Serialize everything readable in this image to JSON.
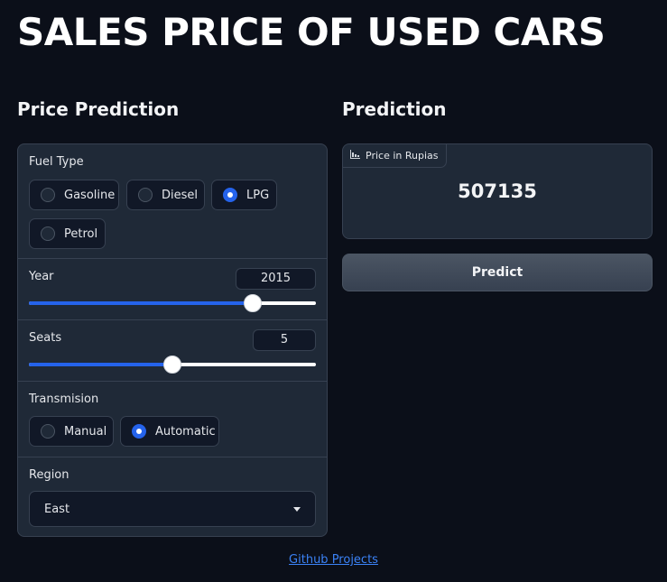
{
  "app": {
    "title": "SALES PRICE OF USED CARS"
  },
  "inputs_panel": {
    "title": "Price Prediction",
    "fuel_type": {
      "label": "Fuel Type",
      "options": [
        "Gasoline",
        "Diesel",
        "LPG",
        "Petrol"
      ],
      "selected": "LPG"
    },
    "year": {
      "label": "Year",
      "value": "2015",
      "fraction": 0.78
    },
    "seats": {
      "label": "Seats",
      "value": "5",
      "fraction": 0.5
    },
    "transmission": {
      "label": "Transmision",
      "options": [
        "Manual",
        "Automatic"
      ],
      "selected": "Automatic"
    },
    "region": {
      "label": "Region",
      "value": "East"
    }
  },
  "output_panel": {
    "title": "Prediction",
    "output_label": "Price in Rupias",
    "output_icon": "bar-chart-icon",
    "value": "507135",
    "button_label": "Predict"
  },
  "footer": {
    "link_text": "Github Projects"
  },
  "colors": {
    "background": "#0b0f19",
    "panel": "#1f2937",
    "accent": "#2563eb",
    "link": "#3b82f6"
  }
}
